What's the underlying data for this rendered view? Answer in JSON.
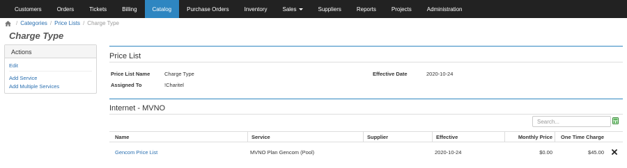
{
  "nav": {
    "items": [
      {
        "label": "Customers"
      },
      {
        "label": "Orders"
      },
      {
        "label": "Tickets"
      },
      {
        "label": "Billing"
      },
      {
        "label": "Catalog",
        "active": true
      },
      {
        "label": "Purchase Orders"
      },
      {
        "label": "Inventory"
      },
      {
        "label": "Sales",
        "dropdown": true
      },
      {
        "label": "Suppliers"
      },
      {
        "label": "Reports"
      },
      {
        "label": "Projects"
      },
      {
        "label": "Administration"
      }
    ],
    "active_color": "#2e86c1",
    "bar_color": "#222222"
  },
  "breadcrumb": {
    "home_icon": "home-icon",
    "items": [
      "Categories",
      "Price Lists"
    ],
    "current": "Charge Type"
  },
  "page_title": "Charge Type",
  "actions": {
    "title": "Actions",
    "edit": "Edit",
    "add_service": "Add Service",
    "add_multiple": "Add Multiple Services"
  },
  "price_list": {
    "section_title": "Price List",
    "name_label": "Price List Name",
    "name_value": "Charge Type",
    "assigned_label": "Assigned To",
    "assigned_value": "!Charitel",
    "effective_label": "Effective Date",
    "effective_value": "2020-10-24"
  },
  "services": {
    "section_title": "Internet - MVNO",
    "search_placeholder": "Search...",
    "export_icon": "excel-export-icon",
    "columns": [
      "Name",
      "Service",
      "Supplier",
      "Effective",
      "Monthly Price",
      "One Time Charge"
    ],
    "rows": [
      {
        "name": "Gencom Price List",
        "service": "MVNO Plan Gencom (Pool)",
        "supplier": "",
        "effective": "2020-10-24",
        "monthly": "$0.00",
        "one_time": "$45.00",
        "delete_icon": "delete-icon"
      }
    ]
  }
}
